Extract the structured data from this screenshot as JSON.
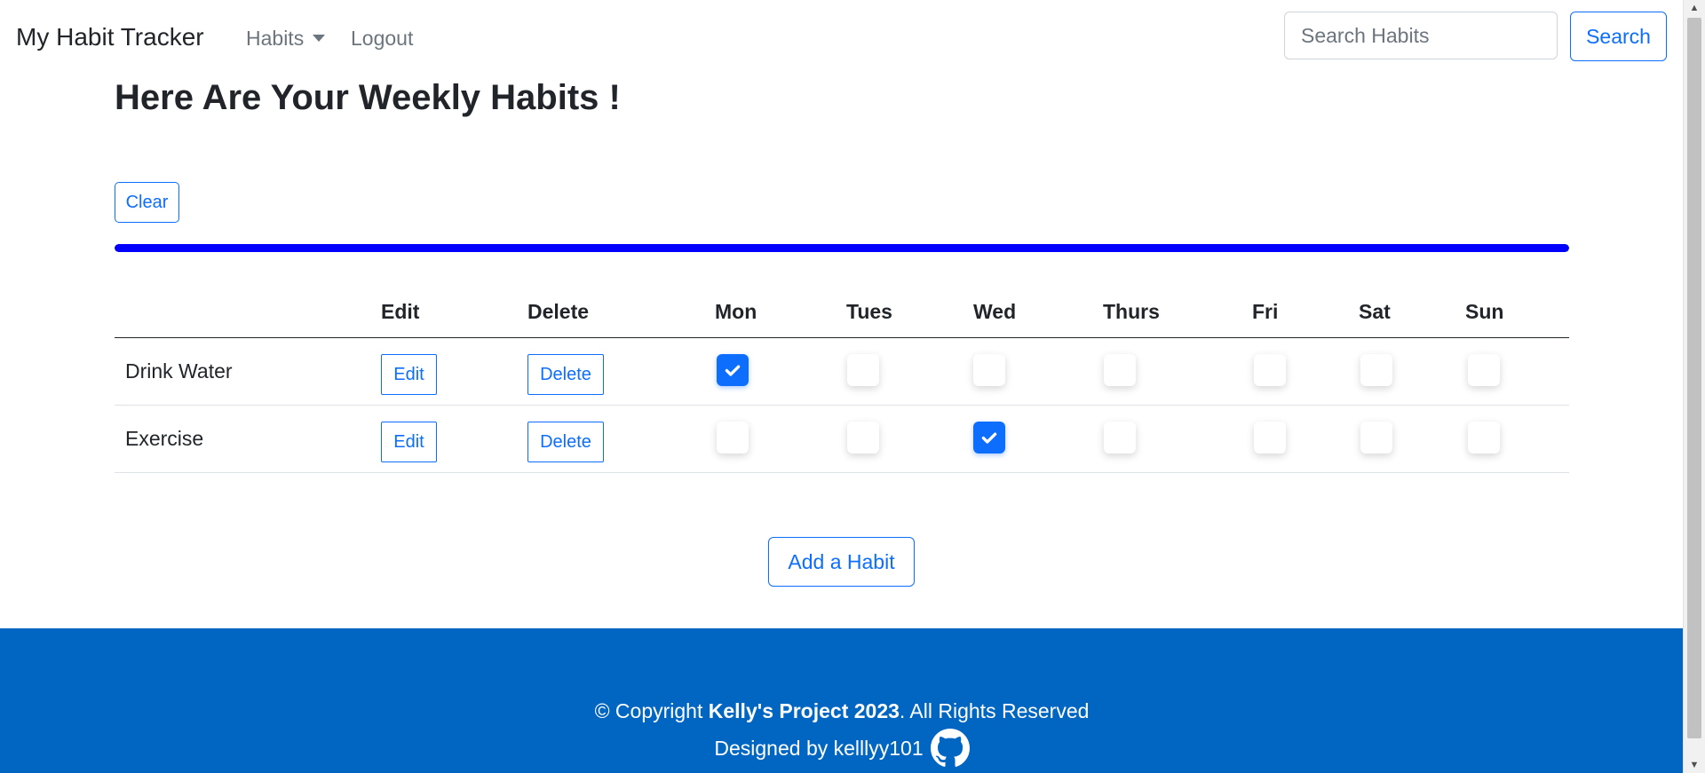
{
  "navbar": {
    "brand": "My Habit Tracker",
    "habits_label": "Habits",
    "logout_label": "Logout",
    "search_placeholder": "Search Habits",
    "search_value": "",
    "search_button": "Search"
  },
  "main": {
    "title": "Here Are Your Weekly Habits !",
    "clear_label": "Clear",
    "progress_fraction": 1.0,
    "progress_color": "#0000ff",
    "add_habit_label": "Add a Habit"
  },
  "table": {
    "headers": [
      "",
      "Edit",
      "Delete",
      "Mon",
      "Tues",
      "Wed",
      "Thurs",
      "Fri",
      "Sat",
      "Sun"
    ],
    "rows": [
      {
        "name": "Drink Water",
        "edit_label": "Edit",
        "delete_label": "Delete",
        "days": [
          true,
          false,
          false,
          false,
          false,
          false,
          false
        ]
      },
      {
        "name": "Exercise",
        "edit_label": "Edit",
        "delete_label": "Delete",
        "days": [
          false,
          false,
          true,
          false,
          false,
          false,
          false
        ]
      }
    ]
  },
  "footer": {
    "copyright_prefix": "© Copyright ",
    "copyright_bold": "Kelly's Project 2023",
    "copyright_suffix": ". All Rights Reserved",
    "designed_by": "Designed by kelllyy101",
    "icon": "github-icon"
  },
  "colors": {
    "primary": "#0d6efd",
    "footer_bg": "#0066c2",
    "progress": "#0000ff",
    "text": "#212529",
    "muted": "#6c757d"
  }
}
